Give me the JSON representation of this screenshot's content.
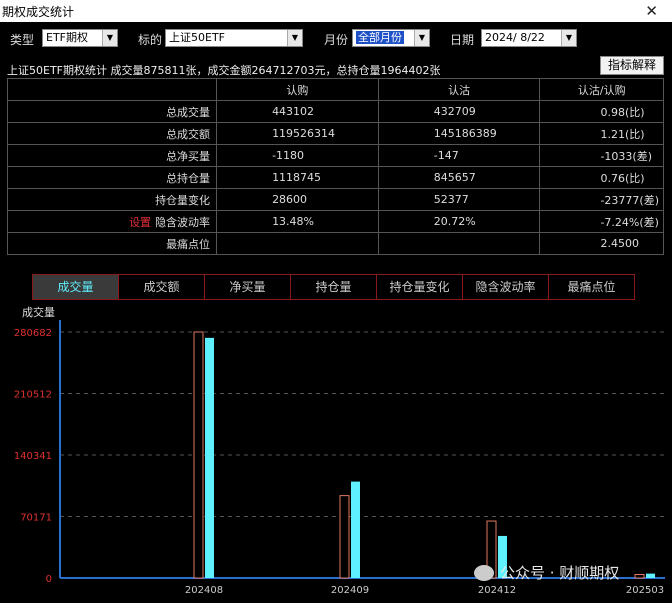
{
  "window": {
    "title": "期权成交统计"
  },
  "filters": {
    "type_label": "类型",
    "type_value": "ETF期权",
    "underlying_label": "标的",
    "underlying_value": "上证50ETF",
    "month_label": "月份",
    "month_value": "全部月份",
    "date_label": "日期",
    "date_value": "2024/ 8/22"
  },
  "summary": {
    "text": "上证50ETF期权统计 成交量875811张，成交金额264712703元，总持仓量1964402张"
  },
  "explain_button": "指标解释",
  "table": {
    "headers": [
      "认购",
      "认沽",
      "认沽/认购"
    ],
    "setting_label": "设置",
    "rows": [
      {
        "label": "总成交量",
        "call": "443102",
        "put": "432709",
        "ratio": "0.98(比)"
      },
      {
        "label": "总成交额",
        "call": "119526314",
        "put": "145186389",
        "ratio": "1.21(比)"
      },
      {
        "label": "总净买量",
        "call": "-1180",
        "put": "-147",
        "ratio": "-1033(差)"
      },
      {
        "label": "总持仓量",
        "call": "1118745",
        "put": "845657",
        "ratio": "0.76(比)"
      },
      {
        "label": "持仓量变化",
        "call": "28600",
        "put": "52377",
        "ratio": "-23777(差)"
      },
      {
        "label": "隐含波动率",
        "call": "13.48%",
        "put": "20.72%",
        "ratio": "-7.24%(差)"
      },
      {
        "label": "最痛点位",
        "call": "",
        "put": "",
        "ratio": "2.4500"
      }
    ]
  },
  "tabs": [
    {
      "label": "成交量",
      "active": true
    },
    {
      "label": "成交额"
    },
    {
      "label": "净买量"
    },
    {
      "label": "持仓量"
    },
    {
      "label": "持仓量变化"
    },
    {
      "label": "隐含波动率"
    },
    {
      "label": "最痛点位"
    }
  ],
  "watermark": "公众号 · 财顺期权",
  "chart_data": {
    "type": "bar",
    "title": "成交量",
    "categories": [
      "202408",
      "202409",
      "202412",
      "202503"
    ],
    "series": [
      {
        "values": [
          280682,
          94000,
          65000,
          4000
        ],
        "color": "#000000",
        "stroke": "#e07a5f"
      },
      {
        "values": [
          274000,
          110000,
          48000,
          5000
        ],
        "color": "#5ff0ff"
      }
    ],
    "yticks": [
      0,
      70171,
      140341,
      210512,
      280682
    ],
    "ylim": [
      0,
      280682
    ],
    "grid": true,
    "colors": {
      "axis": "#2a6fd0",
      "tick_label": "#e03030",
      "grid": "#555555"
    }
  }
}
